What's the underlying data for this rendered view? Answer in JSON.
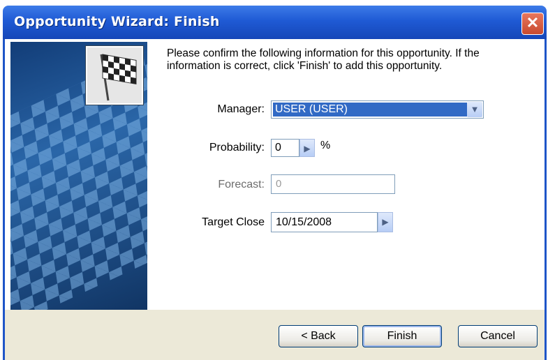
{
  "window": {
    "title": "Opportunity Wizard:  Finish",
    "close_glyph": "✕"
  },
  "intro_text": "Please confirm the following information for this opportunity.  If the information is correct, click 'Finish' to add this opportunity.",
  "fields": {
    "manager": {
      "label": "Manager:",
      "value": "USER (USER)"
    },
    "probability": {
      "label": "Probability:",
      "value": "0",
      "unit": "%"
    },
    "forecast": {
      "label": "Forecast:",
      "value": "0"
    },
    "target_close": {
      "label": "Target Close",
      "value": "10/15/2008"
    }
  },
  "buttons": {
    "back": "< Back",
    "finish": "Finish",
    "cancel": "Cancel"
  },
  "icons": {
    "flag": "checkered-flag-icon",
    "dropdown": "chevron-down-icon",
    "spin": "chevron-right-icon"
  }
}
